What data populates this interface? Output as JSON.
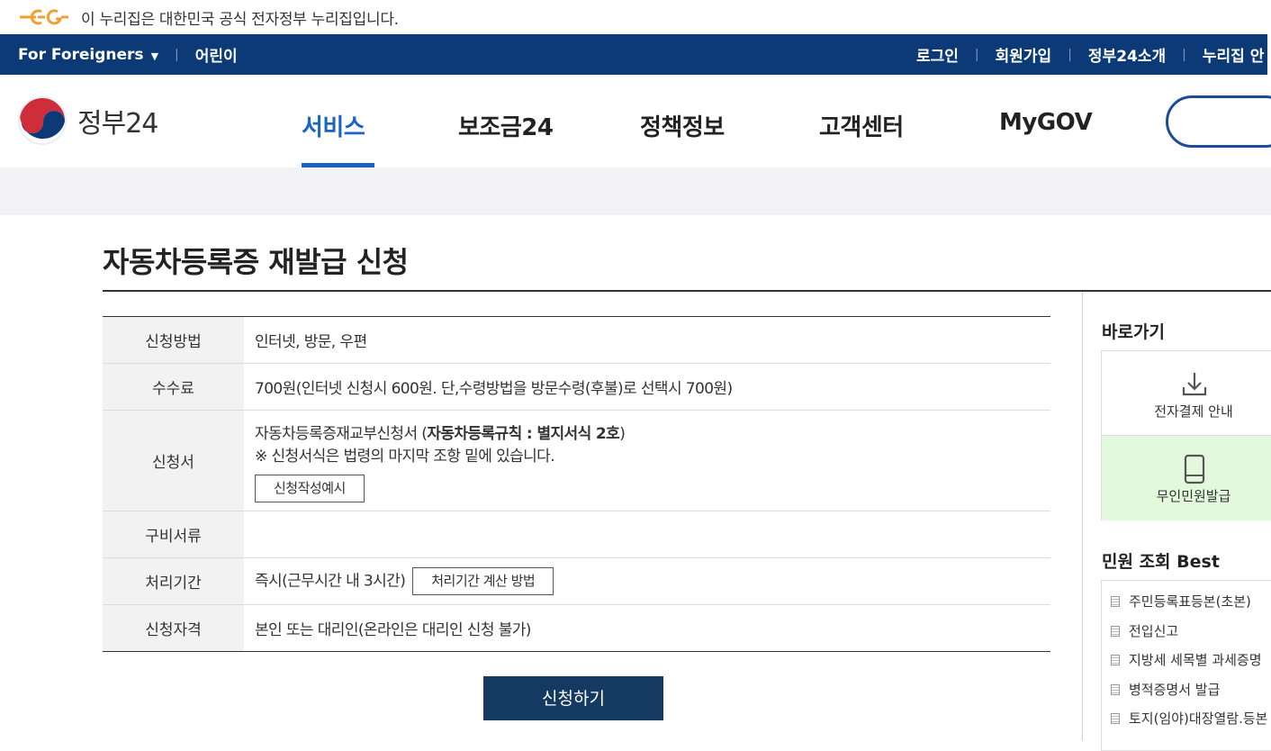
{
  "notice": {
    "text": "이 누리집은 대한민국 공식 전자정부 누리집입니다."
  },
  "utilbar": {
    "foreigners": "For Foreigners",
    "kids": "어린이",
    "login": "로그인",
    "signup": "회원가입",
    "about": "정부24소개",
    "sitemap": "누리집 안"
  },
  "header": {
    "logo_text": "정부24",
    "nav": [
      "서비스",
      "보조금24",
      "정책정보",
      "고객센터",
      "MyGOV"
    ],
    "active_nav": "서비스"
  },
  "colors": {
    "utilbar": "#0b3a77",
    "accent": "#1a63c7",
    "apply_button": "#143a63",
    "highlight": "#e3f9dd"
  },
  "page": {
    "title": "자동차등록증 재발급 신청",
    "rows": {
      "method": {
        "label": "신청방법",
        "value": "인터넷, 방문, 우편"
      },
      "fee": {
        "label": "수수료",
        "value": "700원(인터넷 신청시 600원. 단,수령방법을 방문수령(후불)로 선택시 700원)"
      },
      "form": {
        "label": "신청서",
        "name": "자동차등록증재교부신청서 (",
        "ref": "자동차등록규칙 : 별지서식 2호",
        "close": ")",
        "note": "※ 신청서식은 법령의 마지막 조항 밑에 있습니다.",
        "example_button": "신청작성예시"
      },
      "documents": {
        "label": "구비서류",
        "value": ""
      },
      "period": {
        "label": "처리기간",
        "value": "즉시(근무시간 내 3시간)",
        "calc_button": "처리기간 계산 방법"
      },
      "eligibility": {
        "label": "신청자격",
        "value": "본인 또는 대리인(온라인은 대리인 신청 불가)"
      }
    },
    "apply_button": "신청하기"
  },
  "sidebar": {
    "quick_title": "바로가기",
    "quick_items": [
      {
        "label": "전자결제 안내",
        "icon": "download-icon"
      },
      {
        "label": "무인민원발급",
        "icon": "kiosk-icon"
      }
    ],
    "best_title": "민원 조회 Best",
    "best_items": [
      "주민등록표등본(초본)",
      "전입신고",
      "지방세 세목별 과세증명",
      "병적증명서 발급",
      "토지(임야)대장열람.등본"
    ]
  }
}
